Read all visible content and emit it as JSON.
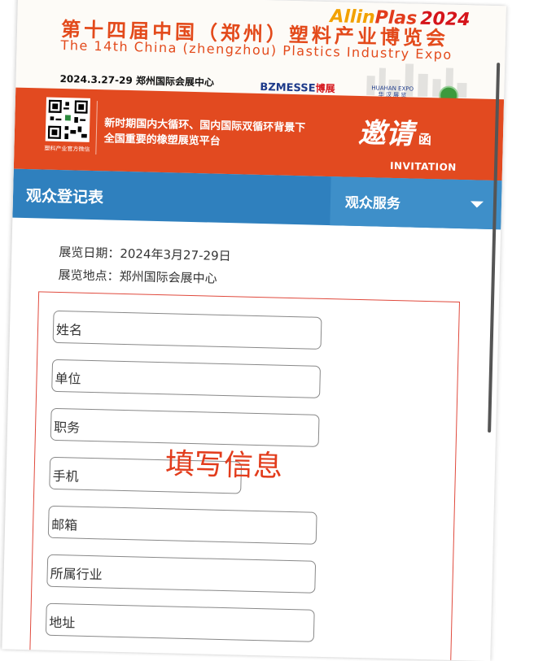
{
  "header": {
    "brand_part1": "Allin",
    "brand_part2": "Plas",
    "brand_year": "2024",
    "title_cn": "第十四届中国（郑州）塑料产业博览会",
    "title_en": "The 14th China (zhengzhou) Plastics Industry Expo",
    "date_venue": "2024.3.27-29  郑州国际会展中心",
    "logo_bzmesse": "BZMESSE",
    "logo_bzmesse_cn": "博展",
    "logo_huahan": "HUAHAN EXPO",
    "logo_huahan_cn": "华 汉 展 览"
  },
  "banner": {
    "qr_label": "塑料产业官方微信",
    "slogan_line1": "新时期国内大循环、国内国际双循环背景下",
    "slogan_line2": "全国重要的橡塑展览平台",
    "invite_cn": "邀请",
    "invite_cn_small": "函",
    "invite_en": "INVITATION"
  },
  "nav": {
    "title": "观众登记表",
    "service_label": "观众服务"
  },
  "info": {
    "date_label": "展览日期：",
    "date_value": "2024年3月27-29日",
    "venue_label": "展览地点：",
    "venue_value": "郑州国际会展中心"
  },
  "form": {
    "fields": [
      {
        "label": "姓名"
      },
      {
        "label": "单位"
      },
      {
        "label": "职务"
      },
      {
        "label": "手机"
      },
      {
        "label": "邮箱"
      },
      {
        "label": "所属行业"
      },
      {
        "label": "地址"
      }
    ],
    "overlay": "填写信息"
  },
  "colors": {
    "accent_red": "#e24a20",
    "nav_blue": "#2f80be",
    "nav_blue_light": "#3e8fc9"
  }
}
